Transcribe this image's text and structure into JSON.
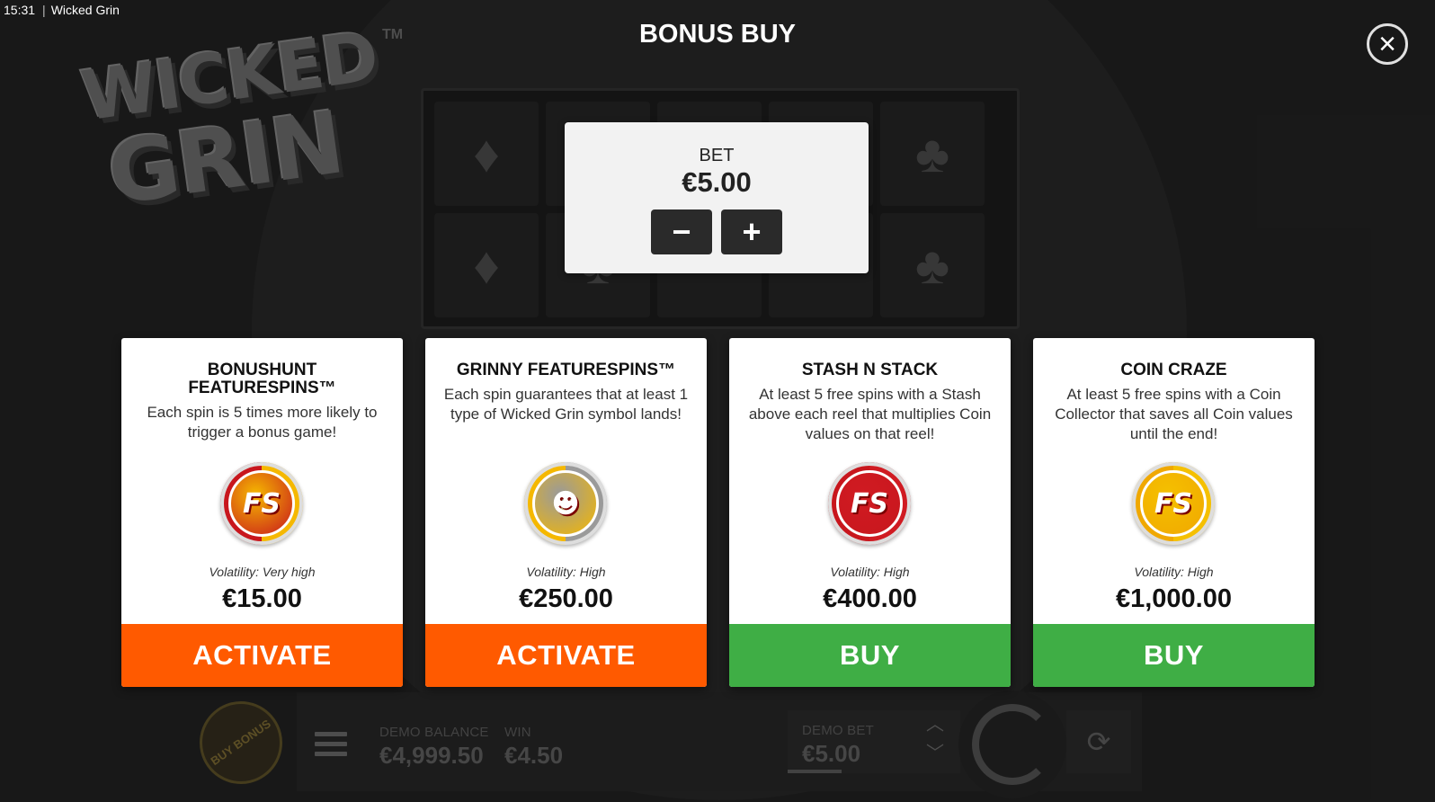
{
  "status_bar": {
    "time": "15:31",
    "app_name": "Wicked Grin"
  },
  "logo": {
    "line1": "WICKED",
    "line2": "GRIN",
    "tm": "TM"
  },
  "modal": {
    "title": "BONUS BUY",
    "bet": {
      "label": "BET",
      "value": "€5.00",
      "minus": "−",
      "plus": "+"
    },
    "cards": [
      {
        "title": "BONUSHUNT FEATURESPINS™",
        "description": "Each spin is 5 times more likely to trigger a bonus game!",
        "icon_name": "fs-x5-icon",
        "icon_text": "FS",
        "icon_colors": [
          "#c8161d",
          "#f5b800"
        ],
        "volatility": "Volatility: Very high",
        "price": "€15.00",
        "action": "ACTIVATE",
        "action_color": "#ff5a00"
      },
      {
        "title": "GRINNY FEATURESPINS™",
        "description": "Each spin guarantees that at least 1 type of Wicked Grin symbol lands!",
        "icon_name": "grinny-skull-icon",
        "icon_text": "☻",
        "icon_colors": [
          "#f5b800",
          "#9a9a9a"
        ],
        "volatility": "Volatility: High",
        "price": "€250.00",
        "action": "ACTIVATE",
        "action_color": "#ff5a00"
      },
      {
        "title": "STASH N STACK",
        "description": "At least 5 free spins with a Stash above each reel that multiplies Coin values on that reel!",
        "icon_name": "fs-red-icon",
        "icon_text": "FS",
        "icon_colors": [
          "#c8161d",
          "#d01b22"
        ],
        "volatility": "Volatility: High",
        "price": "€400.00",
        "action": "BUY",
        "action_color": "#3fae45"
      },
      {
        "title": "COIN CRAZE",
        "description": "At least 5 free spins with a Coin Collector that saves all Coin values until the end!",
        "icon_name": "fs-gold-icon",
        "icon_text": "FS",
        "icon_colors": [
          "#f0a800",
          "#f5c000"
        ],
        "volatility": "Volatility: High",
        "price": "€1,000.00",
        "action": "BUY",
        "action_color": "#3fae45"
      }
    ]
  },
  "bottom_bar": {
    "buy_bonus": "BUY BONUS",
    "balance_label": "DEMO BALANCE",
    "balance_value": "€4,999.50",
    "win_label": "WIN",
    "win_value": "€4.50",
    "bet_label": "DEMO BET",
    "bet_value": "€5.00"
  },
  "reel_symbols": [
    "♦",
    "♥",
    "",
    "♥",
    "♣",
    "♦",
    "♣",
    "",
    "",
    "♣"
  ]
}
